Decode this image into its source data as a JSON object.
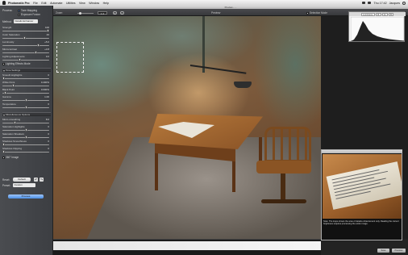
{
  "menubar": {
    "items": [
      "Photomatix Pro",
      "File",
      "Edit",
      "Automate",
      "Utilities",
      "View",
      "Window",
      "Help"
    ],
    "status": "Thu 17:42",
    "user": "Jacques"
  },
  "left_panel": {
    "process_label": "Process:",
    "process_options": [
      "Tone Mapping",
      "Exposure Fusion"
    ],
    "method_label": "Method:",
    "method_value": "Details Enhancer",
    "sliders": [
      {
        "label": "Strength",
        "value": "100"
      },
      {
        "label": "Color Saturation",
        "value": "46"
      },
      {
        "label": "Luminosity",
        "value": "+5.0"
      },
      {
        "label": "Microcontrast",
        "value": "+3.8"
      },
      {
        "label": "Lighting Adjustments",
        "value": "0.0"
      }
    ],
    "smooth_check": "Lighting Effects Mode",
    "section_tone": "Tone Settings",
    "tone_sliders": [
      {
        "label": "Smooth Highlights",
        "value": "0"
      },
      {
        "label": "White Point",
        "value": "0.400%"
      },
      {
        "label": "Black Point",
        "value": "0.000%"
      },
      {
        "label": "Gamma",
        "value": "1.00"
      },
      {
        "label": "Temperature",
        "value": "0"
      }
    ],
    "section_misc": "Miscellaneous Options",
    "misc_sliders": [
      {
        "label": "Micro-smoothing",
        "value": "8.0"
      },
      {
        "label": "Saturation Highlights",
        "value": "0"
      },
      {
        "label": "Saturation Shadows",
        "value": "0"
      },
      {
        "label": "Shadows Smoothness",
        "value": "0"
      },
      {
        "label": "Shadows Clipping",
        "value": "0"
      }
    ],
    "map_check": "360° image",
    "reset_label": "Reset:",
    "reset_value": "Default",
    "preset_label": "Preset:",
    "preset_value": "Custom",
    "process_button": "Process"
  },
  "toolbar": {
    "title": "Preview - ...",
    "zoom_label": "Zoom:",
    "zoom_value": "1:4",
    "preview_label": "Preview",
    "selective_label": "Selection Mode"
  },
  "histogram": {
    "tabs": [
      "Luminance",
      "R",
      "G",
      "B"
    ]
  },
  "loupe": {
    "note": "Note: The loupe shows the area of details enhancement only. Reading the correct brightness requires processing the entire image."
  },
  "bottom": {
    "buttons": [
      "Save",
      "Previous"
    ]
  }
}
